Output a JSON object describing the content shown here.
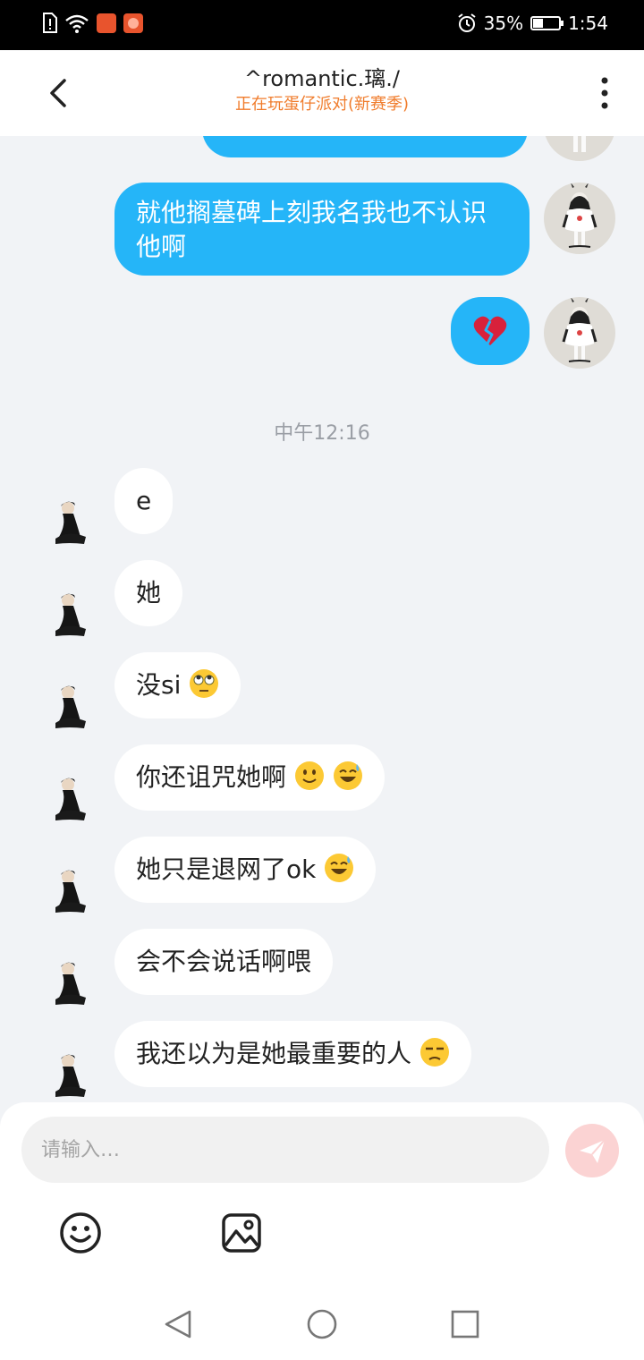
{
  "status_bar": {
    "battery": "35%",
    "time": "1:54"
  },
  "header": {
    "title": "^romantic.璃./",
    "subtitle": "正在玩蛋仔派对(新赛季)"
  },
  "messages_out": [
    {
      "text": "就他搁墓碑上刻我名我也不认识他啊"
    },
    {
      "emoji_name": "broken-heart-emoji"
    }
  ],
  "timestamp": "中午12:16",
  "messages_in": [
    {
      "text": "e"
    },
    {
      "text": "她"
    },
    {
      "text": "没si",
      "emojis": [
        "eye-roll-emoji"
      ]
    },
    {
      "text": "你还诅咒她啊",
      "emojis": [
        "slight-smile-emoji",
        "sweat-smile-emoji"
      ]
    },
    {
      "text": "她只是退网了ok",
      "emojis": [
        "sweat-smile-emoji"
      ]
    },
    {
      "text": "会不会说话啊喂"
    },
    {
      "text": "我还以为是她最重要的人",
      "emojis": [
        "unamused-emoji"
      ]
    }
  ],
  "input": {
    "placeholder": "请输入…"
  },
  "colors": {
    "outgoing_bubble": "#25b5f8",
    "subtitle": "#f07c2c",
    "send_button": "#fbd3d3"
  }
}
